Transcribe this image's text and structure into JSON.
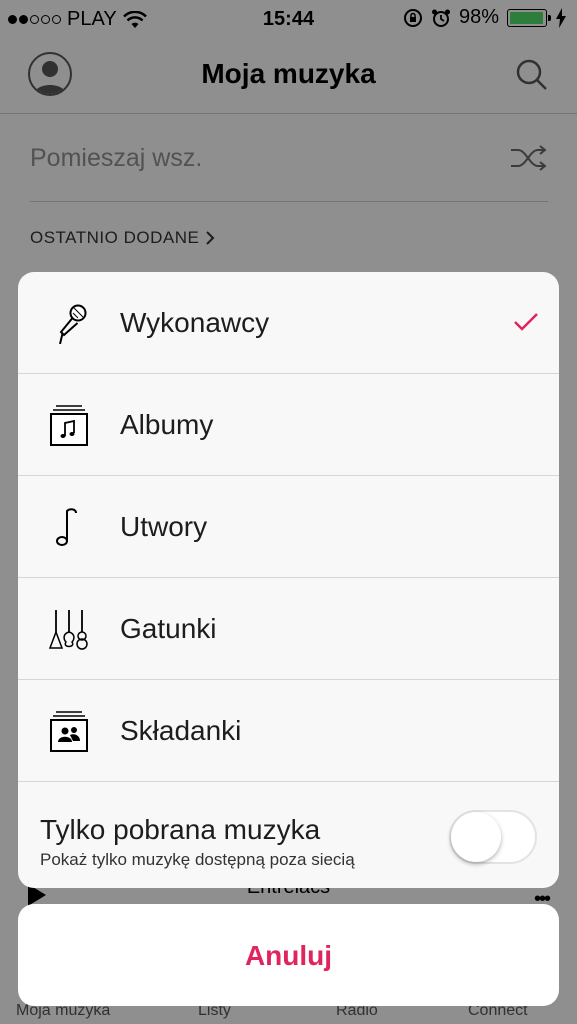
{
  "status_bar": {
    "carrier": "PLAY",
    "time": "15:44",
    "battery_percent": "98%",
    "battery_level": 0.98,
    "signal_bars_filled": 2,
    "icons": [
      "wifi-icon",
      "rotation-lock-icon",
      "alarm-icon",
      "battery-icon",
      "charging-bolt-icon"
    ]
  },
  "nav": {
    "title": "Moja muzyka",
    "left_icon": "profile-avatar-icon",
    "right_icon": "search-icon"
  },
  "library": {
    "shuffle_label": "Pomieszaj wsz.",
    "shuffle_icon": "shuffle-icon",
    "recent_header": "OSTATNIO DODANE"
  },
  "mini_player": {
    "title": "Entrelacs"
  },
  "tab_bar": {
    "tabs": [
      {
        "label": "Moja muzyka"
      },
      {
        "label": "Listy"
      },
      {
        "label": "Radio"
      },
      {
        "label": "Connect"
      }
    ]
  },
  "sheet": {
    "items": [
      {
        "label": "Wykonawcy",
        "icon": "microphone-icon",
        "selected": true
      },
      {
        "label": "Albumy",
        "icon": "album-stack-icon",
        "selected": false
      },
      {
        "label": "Utwory",
        "icon": "music-note-icon",
        "selected": false
      },
      {
        "label": "Gatunki",
        "icon": "guitars-icon",
        "selected": false
      },
      {
        "label": "Składanki",
        "icon": "compilation-icon",
        "selected": false
      }
    ],
    "offline": {
      "title": "Tylko pobrana muzyka",
      "subtitle": "Pokaż tylko muzykę dostępną poza siecią",
      "enabled": false
    },
    "cancel_label": "Anuluj"
  },
  "colors": {
    "accent": "#e0245e",
    "battery": "#4cd964"
  }
}
